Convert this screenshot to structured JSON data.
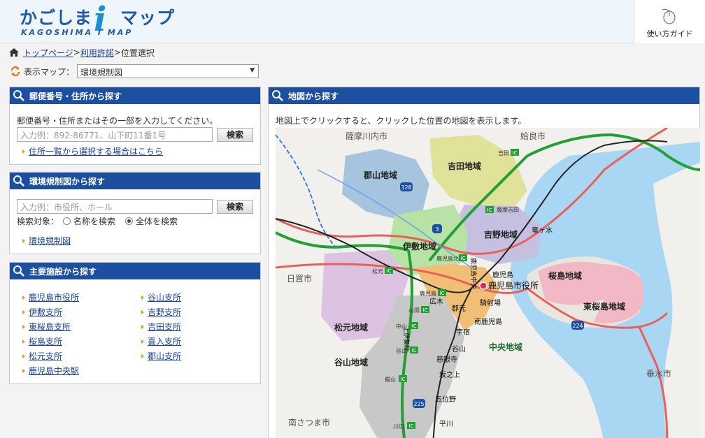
{
  "header": {
    "logo_text": "かごしま",
    "logo_i": "i",
    "logo_text2": "マップ",
    "logo_en": "KAGOSHIMA I MAP",
    "guide_label": "使い方ガイド"
  },
  "breadcrumb": {
    "top": "トップページ",
    "sep1": ">",
    "terms": "利用許諾",
    "sep2": ">",
    "current": "位置選択"
  },
  "map_select": {
    "label": "表示マップ：",
    "value": "環境規制図"
  },
  "postal_panel": {
    "title": "郵便番号・住所から探す",
    "description": "郵便番号・住所またはその一部を入力してください。",
    "placeholder": "入力例：892-86771、山下町11番1号",
    "search_button": "検索",
    "list_link": "住所一覧から選択する場合はこちら"
  },
  "env_panel": {
    "title": "環境規制図から探す",
    "placeholder": "入力例：市役所、ホール",
    "search_button": "検索",
    "target_label": "検索対象：",
    "radio_name": "名称を検索",
    "radio_all": "全体を検索",
    "selected": "全体を検索",
    "link": "環境規制図"
  },
  "facility_panel": {
    "title": "主要施設から探す",
    "left": [
      "鹿児島市役所",
      "伊敷支所",
      "東桜島支所",
      "桜島支所",
      "松元支所",
      "鹿児島中央駅"
    ],
    "right": [
      "谷山支所",
      "吉野支所",
      "吉田支所",
      "喜入支所",
      "郡山支所"
    ]
  },
  "map_panel": {
    "title": "地図から探す",
    "description": "地図上でクリックすると、クリックした位置の地図を表示します。",
    "region_labels": {
      "satsuma_sendai": "薩摩川内市",
      "aira": "姶良市",
      "hioki": "日置市",
      "minamisatsuma": "南さつま市",
      "tarumizu": "垂水市",
      "koriyama": "郡山地域",
      "yoshida": "吉田地域",
      "yoshino": "吉野地域",
      "ishiki": "伊敷地域",
      "sakurajima": "桜島地域",
      "higashisakurajima": "東桜島地域",
      "matsumoto": "松元地域",
      "chuo": "中央地域",
      "taniyama": "谷山地域"
    },
    "places": {
      "city_hall": "鹿児島市役所",
      "kagoshima": "鹿児島",
      "kagoshima_chuo": "鹿児島中央",
      "ryugamizu": "竜ヶ水",
      "kagoshimakita": "鹿児島北",
      "satsumakariya": "薩摩吉田",
      "yoshida_ic": "吉田",
      "matsumoto_ic": "松元",
      "satsuma_matsumoto": "薩摩松元",
      "kamiijuin": "上伊集院",
      "hiroki": "広木",
      "korimoto": "郡元",
      "usuki": "宇宿",
      "minamikagoshima": "南鹿児島",
      "koraicho": "騎射場",
      "taniyama": "谷山",
      "jigenji": "慈眼寺",
      "sakanoue": "坂之上",
      "goino": "五位野",
      "hirakawa": "平川",
      "kagoshima_ic": "鹿児島",
      "yamada_ic": "山田",
      "nakayama_ic": "中山",
      "taniyama_ic": "谷山",
      "kawanabe_ic": "川辺",
      "sakuyama_ic": "錫山"
    },
    "route_numbers": [
      "328",
      "3",
      "224",
      "225"
    ],
    "ic_badge": "IC"
  },
  "colors": {
    "header_blue": "#1c4fa0",
    "link": "#1a3f99",
    "sea": "#a9d6f2",
    "expressway": "#22a033",
    "national_road": "#e8605a"
  }
}
